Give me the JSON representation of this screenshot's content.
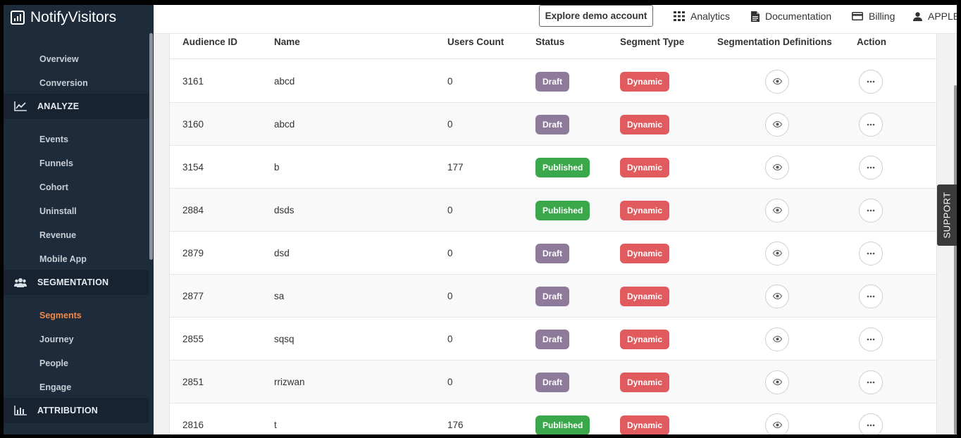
{
  "app": {
    "brand": "NotifyVisitors"
  },
  "sidebar": {
    "items": [
      {
        "label": "Overview",
        "type": "sub"
      },
      {
        "label": "Conversion",
        "type": "sub"
      },
      {
        "label": "ANALYZE",
        "type": "section",
        "icon": "line-chart-icon"
      },
      {
        "label": "Events",
        "type": "sub"
      },
      {
        "label": "Funnels",
        "type": "sub"
      },
      {
        "label": "Cohort",
        "type": "sub"
      },
      {
        "label": "Uninstall",
        "type": "sub"
      },
      {
        "label": "Revenue",
        "type": "sub"
      },
      {
        "label": "Mobile App",
        "type": "sub"
      },
      {
        "label": "SEGMENTATION",
        "type": "section",
        "icon": "users-icon"
      },
      {
        "label": "Segments",
        "type": "sub",
        "active": true
      },
      {
        "label": "Journey",
        "type": "sub"
      },
      {
        "label": "People",
        "type": "sub"
      },
      {
        "label": "Engage",
        "type": "sub"
      },
      {
        "label": "ATTRIBUTION",
        "type": "section",
        "icon": "bar-chart-icon"
      }
    ]
  },
  "topbar": {
    "demo_button": "Explore demo account",
    "nav": [
      {
        "label": "Analytics",
        "icon": "grid-icon"
      },
      {
        "label": "Documentation",
        "icon": "document-icon"
      },
      {
        "label": "Billing",
        "icon": "credit-card-icon"
      },
      {
        "label": "APPLE",
        "icon": "user-icon"
      }
    ]
  },
  "table": {
    "columns": [
      "Audience ID",
      "Name",
      "Users Count",
      "Status",
      "Segment Type",
      "Segmentation Definitions",
      "Action"
    ],
    "rows": [
      {
        "id": "3161",
        "name": "abcd",
        "users": "0",
        "status": "Draft",
        "type": "Dynamic"
      },
      {
        "id": "3160",
        "name": "abcd",
        "users": "0",
        "status": "Draft",
        "type": "Dynamic"
      },
      {
        "id": "3154",
        "name": "b",
        "users": "177",
        "status": "Published",
        "type": "Dynamic"
      },
      {
        "id": "2884",
        "name": "dsds",
        "users": "0",
        "status": "Published",
        "type": "Dynamic"
      },
      {
        "id": "2879",
        "name": "dsd",
        "users": "0",
        "status": "Draft",
        "type": "Dynamic"
      },
      {
        "id": "2877",
        "name": "sa",
        "users": "0",
        "status": "Draft",
        "type": "Dynamic"
      },
      {
        "id": "2855",
        "name": "sqsq",
        "users": "0",
        "status": "Draft",
        "type": "Dynamic"
      },
      {
        "id": "2851",
        "name": "rrizwan",
        "users": "0",
        "status": "Draft",
        "type": "Dynamic"
      },
      {
        "id": "2816",
        "name": "t",
        "users": "176",
        "status": "Published",
        "type": "Dynamic"
      }
    ]
  },
  "support_tab": "SUPPORT",
  "colors": {
    "sidebar_bg": "#1e2b3b",
    "active_item": "#f08a4b",
    "draft": "#8e7a9b",
    "published": "#3aa84a",
    "dynamic": "#e05a5e"
  }
}
